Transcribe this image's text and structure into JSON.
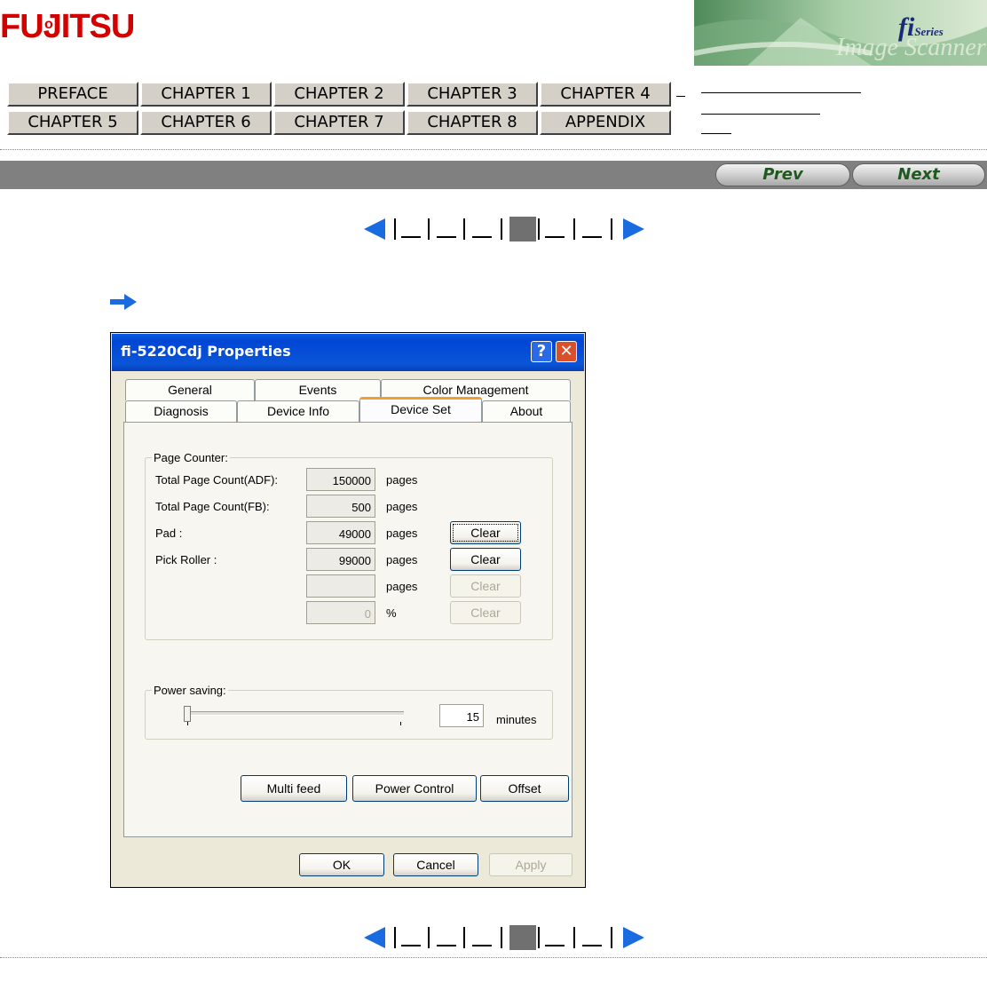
{
  "logo": {
    "text": "FUJITSU",
    "dot": "o"
  },
  "banner": {
    "series_big": "fi",
    "series_small": "Series",
    "script": "Image Scanner"
  },
  "nav": {
    "chapters_row1": [
      "PREFACE",
      "CHAPTER 1",
      "CHAPTER 2",
      "CHAPTER 3",
      "CHAPTER 4"
    ],
    "chapters_row2": [
      "CHAPTER 5",
      "CHAPTER 6",
      "CHAPTER 7",
      "CHAPTER 8",
      "APPENDIX"
    ]
  },
  "toolbar": {
    "prev_label": "Prev",
    "next_label": "Next"
  },
  "dialog": {
    "title": "fi-5220Cdj Properties",
    "help_symbol": "?",
    "close_symbol": "✕",
    "tabs_row1": [
      "General",
      "Events",
      "Color Management"
    ],
    "tabs_row2": [
      "Diagnosis",
      "Device Info",
      "Device Set",
      "About"
    ],
    "active_tab": "Device Set",
    "page_counter": {
      "legend": "Page Counter:",
      "rows": [
        {
          "label": "Total Page Count(ADF):",
          "value": "150000",
          "unit": "pages"
        },
        {
          "label": "Total Page Count(FB):",
          "value": "500",
          "unit": "pages"
        },
        {
          "label": "Pad :",
          "value": "49000",
          "unit": "pages",
          "button": "Clear"
        },
        {
          "label": "Pick Roller :",
          "value": "99000",
          "unit": "pages",
          "button": "Clear"
        },
        {
          "label": "",
          "value": "",
          "unit": "pages",
          "button": "Clear"
        },
        {
          "label": "",
          "value": "0",
          "unit": "%",
          "button": "Clear"
        }
      ]
    },
    "power_saving": {
      "legend": "Power saving:",
      "value": "15",
      "unit": "minutes"
    },
    "buttons": {
      "multi_feed": "Multi feed",
      "power_control": "Power Control",
      "offset": "Offset"
    },
    "footer": {
      "ok": "OK",
      "cancel": "Cancel",
      "apply": "Apply"
    }
  }
}
